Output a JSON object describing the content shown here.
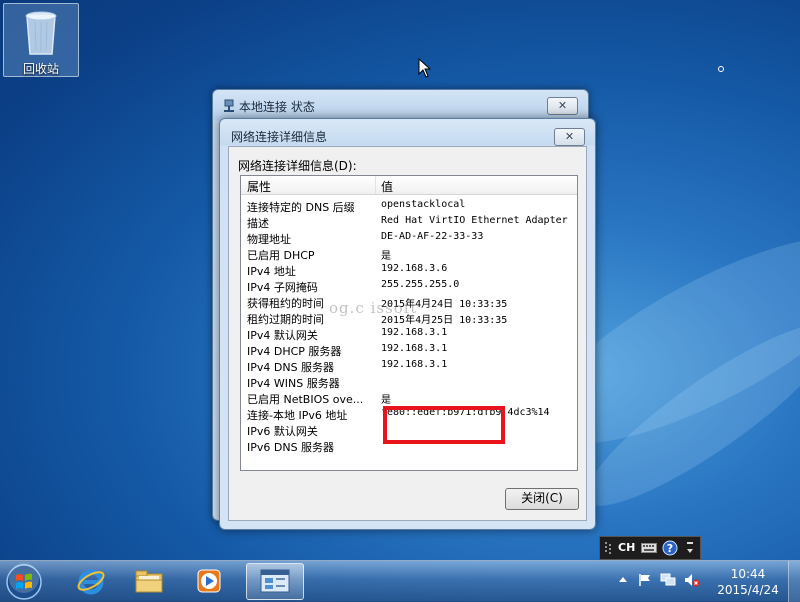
{
  "desktop": {
    "recycle_bin_label": "回收站"
  },
  "status_window": {
    "title": "本地连接 状态",
    "close_glyph": "✕"
  },
  "details_window": {
    "title": "网络连接详细信息",
    "close_glyph": "✕",
    "group_label": "网络连接详细信息(D):",
    "columns": {
      "property": "属性",
      "value": "值"
    },
    "rows": [
      {
        "property": "连接特定的 DNS 后缀",
        "value": "openstacklocal"
      },
      {
        "property": "描述",
        "value": "Red Hat VirtIO Ethernet Adapter"
      },
      {
        "property": "物理地址",
        "value": "DE-AD-AF-22-33-33"
      },
      {
        "property": "已启用 DHCP",
        "value": "是"
      },
      {
        "property": "IPv4 地址",
        "value": "192.168.3.6"
      },
      {
        "property": "IPv4 子网掩码",
        "value": "255.255.255.0"
      },
      {
        "property": "获得租约的时间",
        "value": "2015年4月24日 10:33:35"
      },
      {
        "property": "租约过期的时间",
        "value": "2015年4月25日 10:33:35"
      },
      {
        "property": "IPv4 默认网关",
        "value": "192.168.3.1"
      },
      {
        "property": "IPv4 DHCP 服务器",
        "value": "192.168.3.1"
      },
      {
        "property": "IPv4 DNS 服务器",
        "value": "192.168.3.1"
      },
      {
        "property": "IPv4 WINS 服务器",
        "value": ""
      },
      {
        "property": "已启用 NetBIOS ove...",
        "value": "是"
      },
      {
        "property": "连接-本地 IPv6 地址",
        "value": "fe80::edef:b971:dfb9:4dc3%14"
      },
      {
        "property": "IPv6 默认网关",
        "value": ""
      },
      {
        "property": "IPv6 DNS 服务器",
        "value": ""
      }
    ],
    "watermark": "og.c                        issoft",
    "close_button": "关闭(C)",
    "highlight_color": "#e8141c"
  },
  "tray_popup": {
    "language": "CH"
  },
  "taskbar": {
    "time": "10:44",
    "date": "2015/4/24"
  },
  "icons": {
    "recycle_bin": "recycle-bin-icon",
    "network": "network-adapter-icon",
    "start": "windows-start-orb-icon",
    "ie": "internet-explorer-icon",
    "explorer": "folder-library-icon",
    "media": "media-player-icon",
    "control_panel": "control-panel-icon"
  },
  "colors": {
    "desktop_blue": "#155aa7",
    "highlight_red": "#e8141c"
  }
}
